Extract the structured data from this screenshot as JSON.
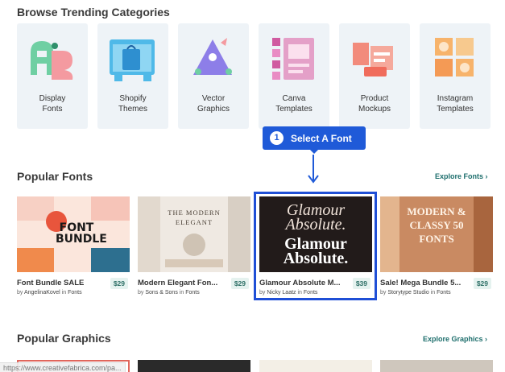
{
  "sections": {
    "browse_title": "Browse Trending Categories",
    "popular_fonts_title": "Popular Fonts",
    "popular_graphics_title": "Popular Graphics",
    "explore_fonts": "Explore Fonts ›",
    "explore_graphics": "Explore Graphics ›"
  },
  "categories": [
    {
      "label": "Display\nFonts",
      "icon": "display-fonts-icon"
    },
    {
      "label": "Shopify\nThemes",
      "icon": "shopify-themes-icon"
    },
    {
      "label": "Vector\nGraphics",
      "icon": "vector-graphics-icon"
    },
    {
      "label": "Canva\nTemplates",
      "icon": "canva-templates-icon"
    },
    {
      "label": "Product\nMockups",
      "icon": "product-mockups-icon"
    },
    {
      "label": "Instagram\nTemplates",
      "icon": "instagram-templates-icon"
    }
  ],
  "callout": {
    "number": "1",
    "text": "Select A Font"
  },
  "products": [
    {
      "name": "Font Bundle SALE",
      "price": "$29",
      "by": "by",
      "author": "AngelinaKovel",
      "in": "in",
      "category": "Fonts",
      "thumb_text": "FONT BUNDLE"
    },
    {
      "name": "Modern Elegant Fon...",
      "price": "$29",
      "by": "by",
      "author": "Sons & Sons",
      "in": "in",
      "category": "Fonts",
      "thumb_text": "THE MODERN ELEGANT"
    },
    {
      "name": "Glamour Absolute M...",
      "price": "$39",
      "by": "by",
      "author": "Nicky Laatz",
      "in": "in",
      "category": "Fonts",
      "thumb_text_1": "Glamour Absolute.",
      "thumb_text_2": "Glamour Absolute."
    },
    {
      "name": "Sale! Mega Bundle 5...",
      "price": "$29",
      "by": "by",
      "author": "Storytype Studio",
      "in": "in",
      "category": "Fonts",
      "thumb_text": "MODERN & CLASSY 50 FONTS"
    }
  ],
  "status_url": "https://www.creativefabrica.com/pa...",
  "colors": {
    "accent": "#1f5ad8",
    "link": "#1d6e6c",
    "card_bg": "#eef3f7",
    "price_bg": "#e5f2ef"
  }
}
